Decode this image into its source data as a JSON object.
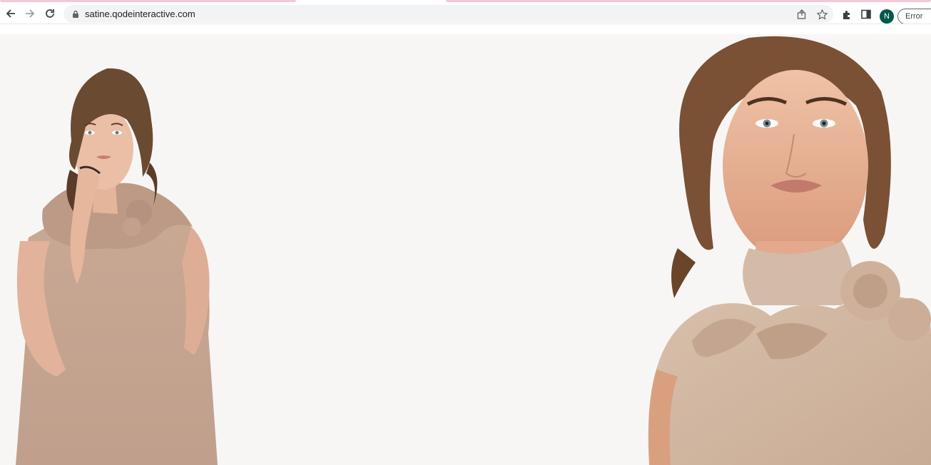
{
  "browser": {
    "nav": {
      "back_icon": "arrow-left-icon",
      "forward_icon": "arrow-right-icon",
      "reload_icon": "reload-icon"
    },
    "address_bar": {
      "url": "satine.qodeinteractive.com",
      "secure_icon": "lock-icon",
      "share_icon": "share-icon",
      "bookmark_icon": "star-icon"
    },
    "toolbar": {
      "extensions_icon": "puzzle-icon",
      "side_panel_icon": "side-panel-icon",
      "profile_initial": "N",
      "profile_color": "#00574b",
      "error_label": "Error"
    },
    "tab_accent_color": "#f4c6dc"
  },
  "hero": {
    "background_color": "#f7f6f5",
    "images": [
      {
        "name": "model-left",
        "description_icon": "fashion-model-image"
      },
      {
        "name": "model-right",
        "description_icon": "fashion-model-closeup-image"
      }
    ]
  }
}
